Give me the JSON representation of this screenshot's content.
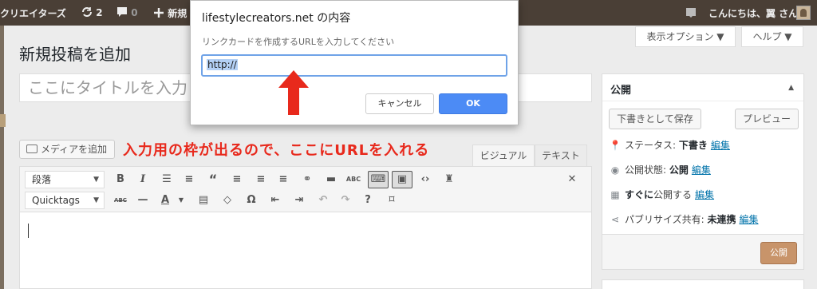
{
  "admin_bar": {
    "site_name": "クリエイターズ",
    "updates_count": "2",
    "comments_count": "0",
    "new_label": "新規",
    "greeting": "こんにちは、翼 さん"
  },
  "header": {
    "screen_options": "表示オプション ▼",
    "help": "ヘルプ ▼"
  },
  "page": {
    "title": "新規投稿を追加",
    "title_placeholder": "ここにタイトルを入力"
  },
  "editor": {
    "media_button": "メディアを追加",
    "annotation": "入力用の枠が出るので、ここにURLを入れる",
    "tab_visual": "ビジュアル",
    "tab_text": "テキスト",
    "format_select": "段落",
    "quicktags_select": "Quicktags"
  },
  "publish": {
    "heading": "公開",
    "save_draft": "下書きとして保存",
    "preview": "プレビュー",
    "status_label": "ステータス:",
    "status_value": "下書き",
    "visibility_label": "公開状態:",
    "visibility_value": "公開",
    "schedule_bold": "すぐに",
    "schedule_label": "公開する",
    "publicize_label": "パブリサイズ共有:",
    "publicize_value": "未連携",
    "edit_link": "編集",
    "publish_button": "公開"
  },
  "dialog": {
    "title": "lifestylecreators.net の内容",
    "message": "リンクカードを作成するURLを入力してください",
    "input_value": "http://",
    "cancel": "キャンセル",
    "ok": "OK"
  },
  "colors": {
    "admin_bar": "#4a3f36",
    "annotation": "#e8291c",
    "ok_button": "#4c8bf5",
    "publish_button": "#c8946a",
    "link": "#0073aa"
  }
}
